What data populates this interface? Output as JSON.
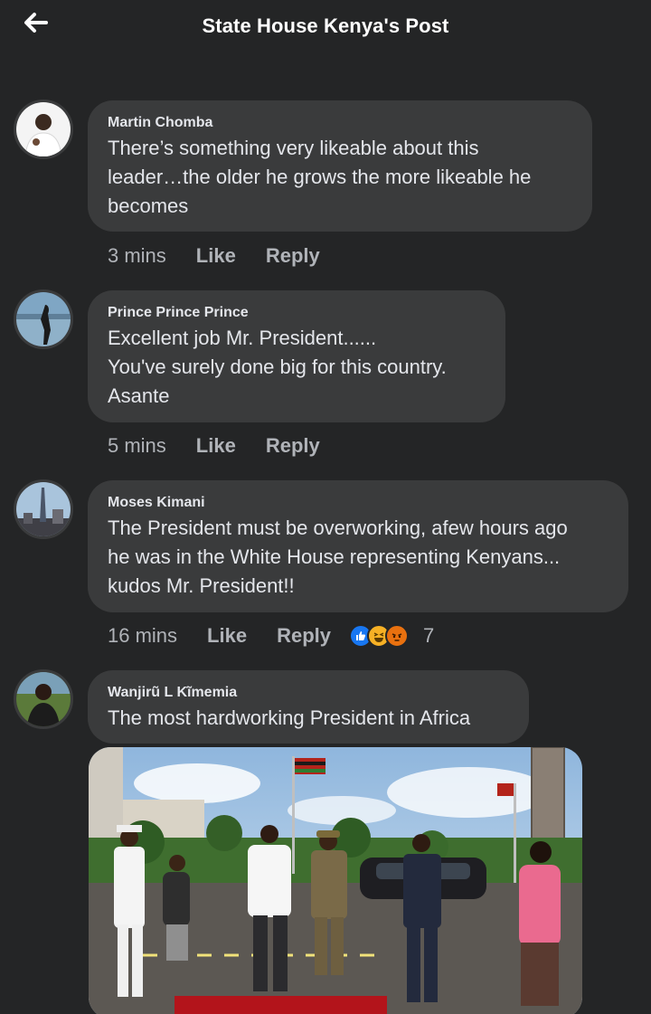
{
  "header": {
    "title": "State House Kenya's Post",
    "back_icon": "arrow-left-icon"
  },
  "comments": [
    {
      "author": "Martin Chomba",
      "text": "There’s something very likeable about this\nleader…the older he grows the more likeable he\nbecomes",
      "time": "3 mins",
      "like": "Like",
      "reply": "Reply"
    },
    {
      "author": "Prince Prince Prince",
      "text": "Excellent job Mr. President......\nYou've surely done big for this country.\nAsante",
      "time": "5 mins",
      "like": "Like",
      "reply": "Reply"
    },
    {
      "author": "Moses Kimani",
      "text": "The President must be overworking, afew hours ago\nhe was in the White House representing Kenyans...\nkudos Mr. President!!",
      "time": "16 mins",
      "like": "Like",
      "reply": "Reply",
      "reactions": {
        "icons": [
          "like-reaction-icon",
          "haha-reaction-icon",
          "angry-reaction-icon"
        ],
        "count": "7"
      }
    },
    {
      "author": "Wanjirũ L Kĩmemia",
      "text": "The most hardworking President in Africa",
      "photo": "attached-photo"
    }
  ],
  "colors": {
    "background": "#242526",
    "bubble": "#3a3b3c",
    "primary_text": "#e4e6eb",
    "secondary_text": "#b0b3b8",
    "like_blue": "#1877f2",
    "haha_yellow": "#f7b125",
    "angry_orange": "#e9710f"
  }
}
